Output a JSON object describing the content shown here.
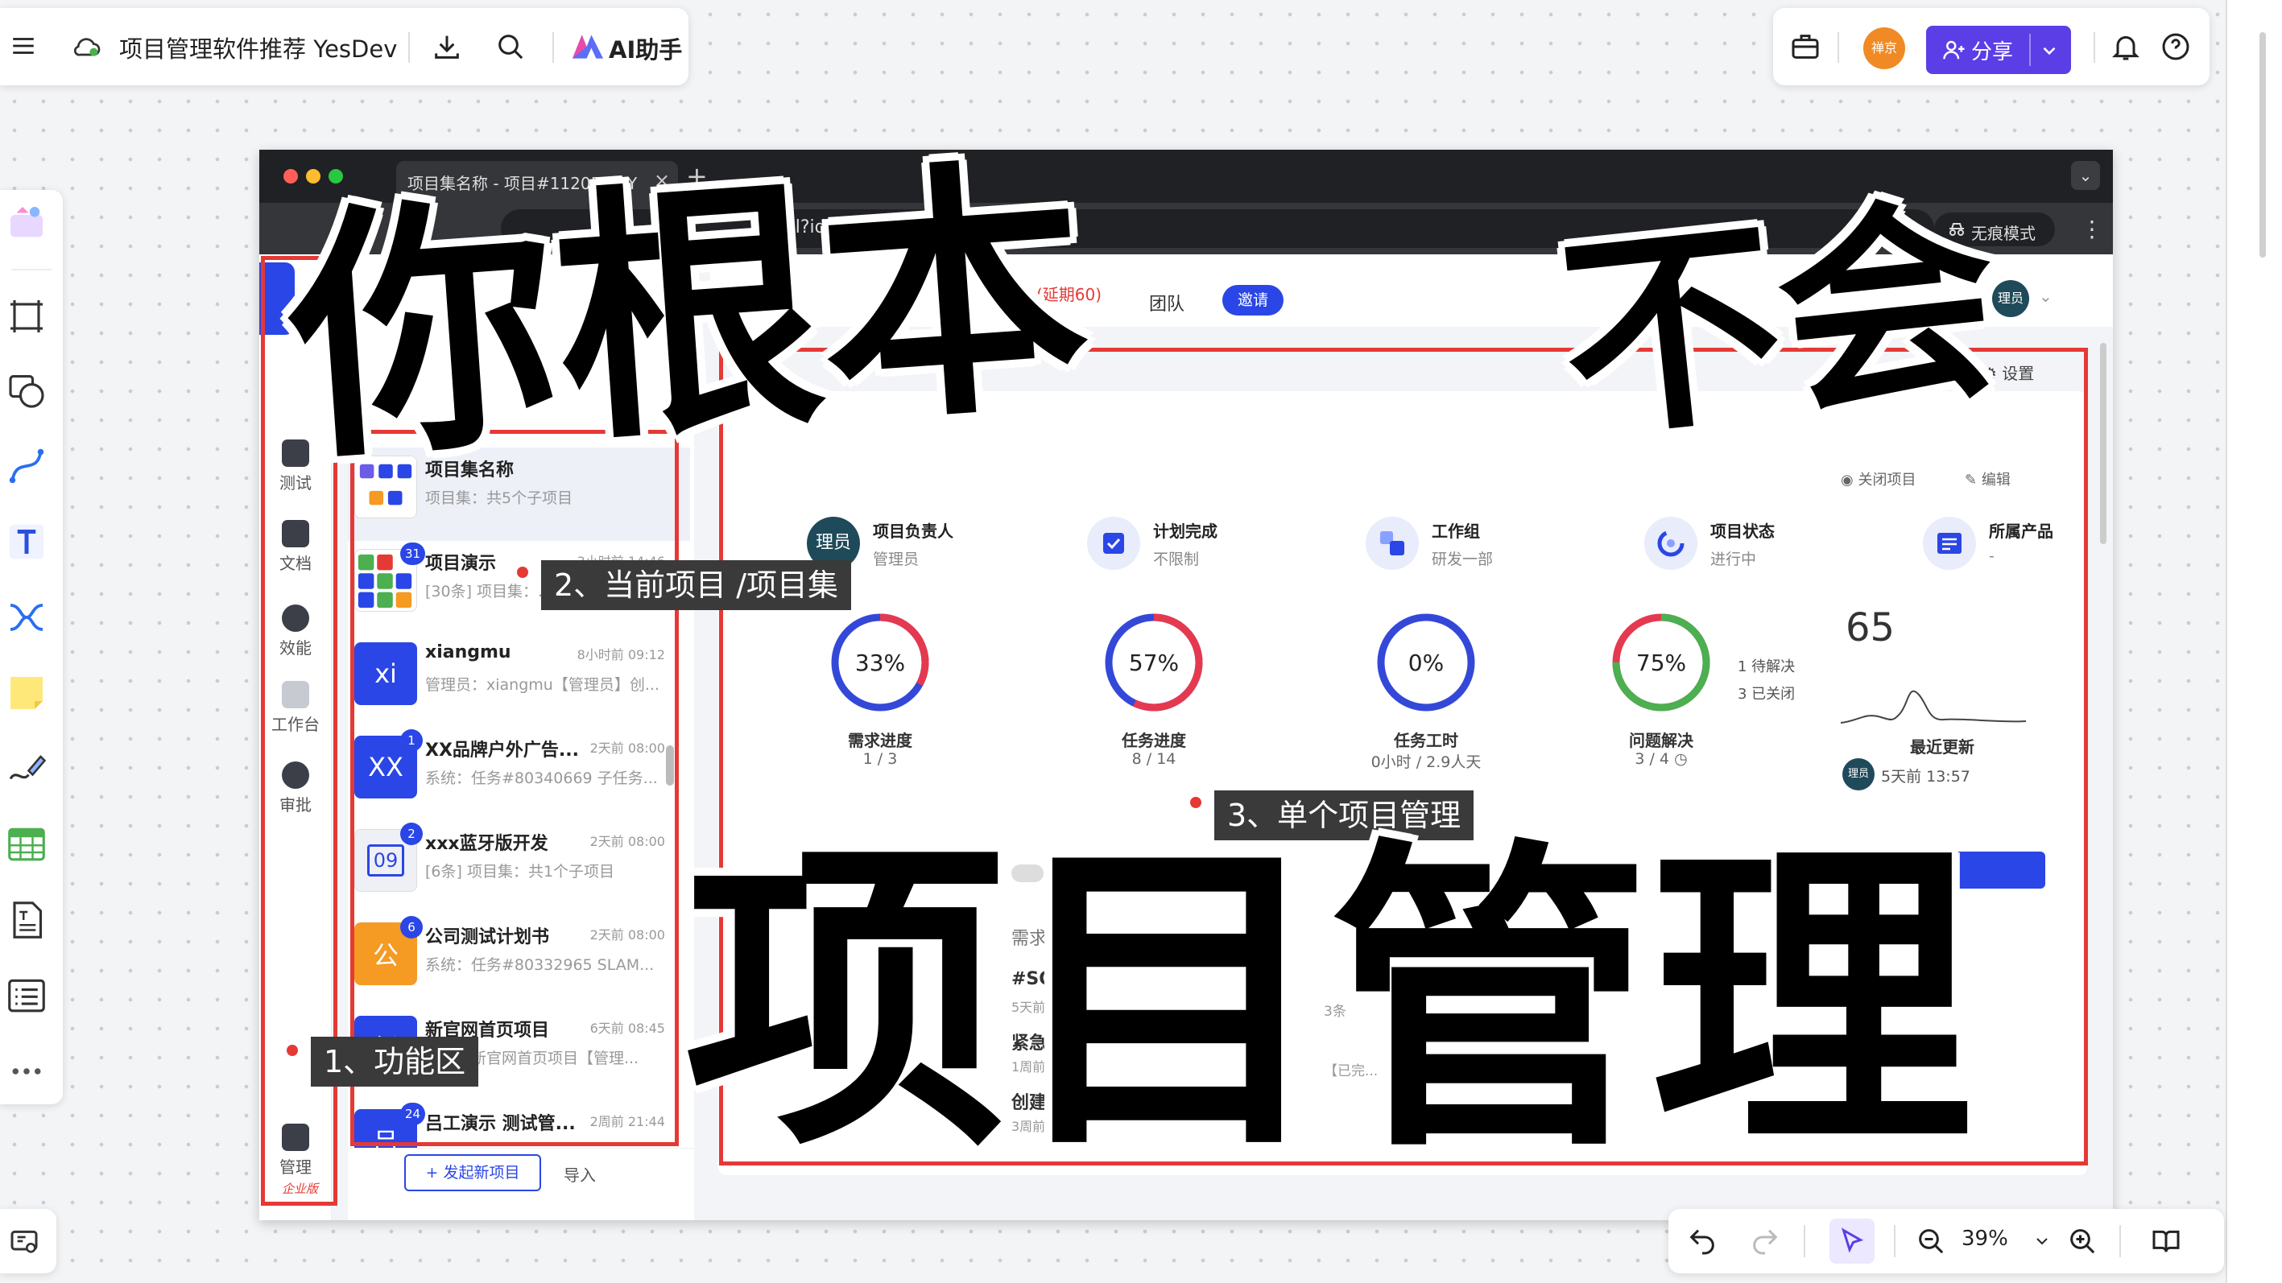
{
  "app": {
    "doc_title": "项目管理软件推荐 YesDev",
    "ai_label": "AI助手",
    "avatar_text": "禅京",
    "share_label": "分享",
    "zoom": "39%",
    "accent": "#5b3ee6"
  },
  "browser": {
    "tab_title": "项目集名称 - 项目#112059 - Y",
    "url": "detail?id=112059",
    "incognito": "无痕模式"
  },
  "app_nav": [
    {
      "label": "测试"
    },
    {
      "label": "文档"
    },
    {
      "label": "效能"
    },
    {
      "label": "工作台"
    },
    {
      "label": "审批"
    },
    {
      "label": "管理"
    }
  ],
  "app_nav_edition": "企业版",
  "project_list": [
    {
      "avatar": "",
      "avatar_color": "#ffffff",
      "name": "项目集名称",
      "time": "",
      "sub": "项目集：共5个子项目",
      "badge": ""
    },
    {
      "avatar": "",
      "avatar_color": "#ffffff",
      "name": "项目演示",
      "time": "3小时前 14:46",
      "sub": "[30条] 项目集：...",
      "badge": "31"
    },
    {
      "avatar": "xi",
      "avatar_color": "#2a46e6",
      "name": "xiangmu",
      "time": "8小时前 09:12",
      "sub": "管理员：xiangmu【管理员】创...",
      "badge": ""
    },
    {
      "avatar": "XX",
      "avatar_color": "#2a46e6",
      "name": "XX品牌户外广告...",
      "time": "2天前 08:00",
      "sub": "系统：任务#80340669 子任务...",
      "badge": "1"
    },
    {
      "avatar": "09",
      "avatar_color": "#eef0f5",
      "name": "xxx蓝牙版开发",
      "time": "2天前 08:00",
      "sub": "[6条] 项目集：共1个子项目",
      "badge": "2"
    },
    {
      "avatar": "公",
      "avatar_color": "#f59a23",
      "name": "公司测试计划书",
      "time": "2天前 08:00",
      "sub": "系统：任务#80332965 SLAM...",
      "badge": "6"
    },
    {
      "avatar": "新",
      "avatar_color": "#2a46e6",
      "name": "新官网首页项目",
      "time": "6天前 08:45",
      "sub": "系统：新官网首页项目【管理...",
      "badge": ""
    },
    {
      "avatar": "吕",
      "avatar_color": "#2a46e6",
      "name": "吕工演示 测试管...",
      "time": "2周前 21:44",
      "sub": "",
      "badge": "24"
    }
  ],
  "list_footer": {
    "new_project": "+ 发起新项目",
    "import": "导入"
  },
  "header": {
    "delay_text": "(延期60)",
    "delay_prefix": "0)",
    "team": "团队",
    "invite": "邀请",
    "user_avatar": "理员",
    "settings": "设置",
    "close_project": "关闭项目",
    "edit": "编辑"
  },
  "stats": [
    {
      "label": "项目负责人",
      "value": "管理员",
      "icon_text": "理员"
    },
    {
      "label": "计划完成",
      "value": "不限制",
      "icon_text": ""
    },
    {
      "label": "工作组",
      "value": "研发一部",
      "icon_text": ""
    },
    {
      "label": "项目状态",
      "value": "进行中",
      "icon_text": ""
    },
    {
      "label": "所属产品",
      "value": "-",
      "icon_text": ""
    }
  ],
  "rings": [
    {
      "percent": 33,
      "text": "33%",
      "label": "需求进度",
      "value": "1 / 3",
      "color": "#e53950",
      "track": "#3448d8"
    },
    {
      "percent": 57,
      "text": "57%",
      "label": "任务进度",
      "value": "8 / 14",
      "color": "#e53950",
      "track": "#3448d8"
    },
    {
      "percent": 0,
      "text": "0%",
      "label": "任务工时",
      "value": "0小时 / 2.9人天",
      "color": "#e53950",
      "track": "#3448d8"
    },
    {
      "percent": 75,
      "text": "75%",
      "label": "问题解决",
      "value": "3 / 4",
      "color": "#4caf50",
      "track": "#e53950"
    }
  ],
  "issues": {
    "pending": "1 待解决",
    "closed": "3 已关闭"
  },
  "updates": {
    "count": "65",
    "label": "最近更新",
    "time": "5天前 13:57",
    "avatar": "理员"
  },
  "annotations": {
    "a1": "1、功能区",
    "a2": "2、当前项目 /项目集",
    "a3": "3、单个项目管理"
  },
  "overlay": {
    "line1": "你根本",
    "line1b": "不会",
    "line2": "项目管理"
  },
  "bottom_list": [
    {
      "title": "需求",
      "sub": ""
    },
    {
      "title": "#SO",
      "sub": "5天前"
    },
    {
      "title": "紧急",
      "sub": "1周前"
    },
    {
      "title": "创建",
      "sub": "3周前"
    }
  ],
  "misc": {
    "count3": "3条",
    "done": "【已完..."
  }
}
